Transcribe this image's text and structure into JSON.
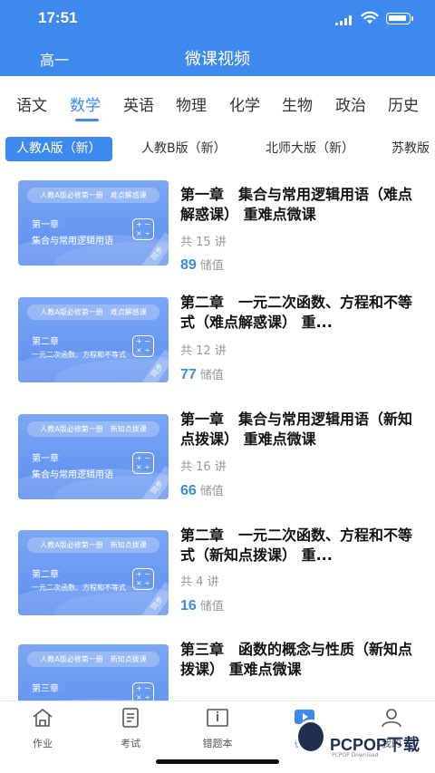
{
  "status": {
    "time": "17:51"
  },
  "header": {
    "grade": "高一",
    "title": "微课视频"
  },
  "subjects": {
    "items": [
      "语文",
      "数学",
      "英语",
      "物理",
      "化学",
      "生物",
      "政治",
      "历史"
    ],
    "active": "数学"
  },
  "editions": {
    "items": [
      "人教A版（新）",
      "人教B版（新）",
      "北师大版（新）",
      "苏教版"
    ],
    "active": "人教A版（新）"
  },
  "courses": [
    {
      "title": "第一章　集合与常用逻辑用语（难点解惑课） 重难点微课",
      "lectures": "共 15 讲",
      "price": "89",
      "unit": "储值",
      "thumb": {
        "header": "人教A版必修第一册　难点解惑课",
        "chapter": "第一章",
        "name": "集合与常用逻辑用语",
        "tag": "同步"
      }
    },
    {
      "title": "第二章　一元二次函数、方程和不等式（难点解惑课） 重...",
      "lectures": "共 12 讲",
      "price": "77",
      "unit": "储值",
      "thumb": {
        "header": "人教A版必修第一册　难点解惑课",
        "chapter": "第二章",
        "name": "一元二次函数、方程和不等式",
        "tag": "同步"
      }
    },
    {
      "title": "第一章　集合与常用逻辑用语（新知点拨课） 重难点微课",
      "lectures": "共 16 讲",
      "price": "66",
      "unit": "储值",
      "thumb": {
        "header": "人教A版必修第一册　新知点拨课",
        "chapter": "第一章",
        "name": "集合与常用逻辑用语",
        "tag": "同步"
      }
    },
    {
      "title": "第二章　一元二次函数、方程和不等式（新知点拨课） 重...",
      "lectures": "共 4 讲",
      "price": "16",
      "unit": "储值",
      "thumb": {
        "header": "人教A版必修第一册　新知点拨课",
        "chapter": "第二章",
        "name": "一元二次函数、方程和不等式",
        "tag": "同步"
      }
    },
    {
      "title": "第三章　函数的概念与性质（新知点拨课） 重难点微课",
      "lectures": "",
      "price": "",
      "unit": "",
      "thumb": {
        "header": "人教A版必修第一册　新知点拨课",
        "chapter": "第三章",
        "name": "",
        "tag": ""
      }
    }
  ],
  "bottom_nav": {
    "items": [
      {
        "label": "作业",
        "icon": "home-icon"
      },
      {
        "label": "考试",
        "icon": "exam-icon"
      },
      {
        "label": "错题本",
        "icon": "book-icon"
      },
      {
        "label": "微课",
        "icon": "play-icon"
      },
      {
        "label": "我的",
        "icon": "user-icon"
      }
    ],
    "active": "微课"
  },
  "watermark": {
    "text": "PCPOP下载",
    "sub": "PCPOP Download"
  },
  "colors": {
    "accent": "#3d89ee",
    "thumb": "#6a98f2",
    "price": "#3d89ee"
  }
}
